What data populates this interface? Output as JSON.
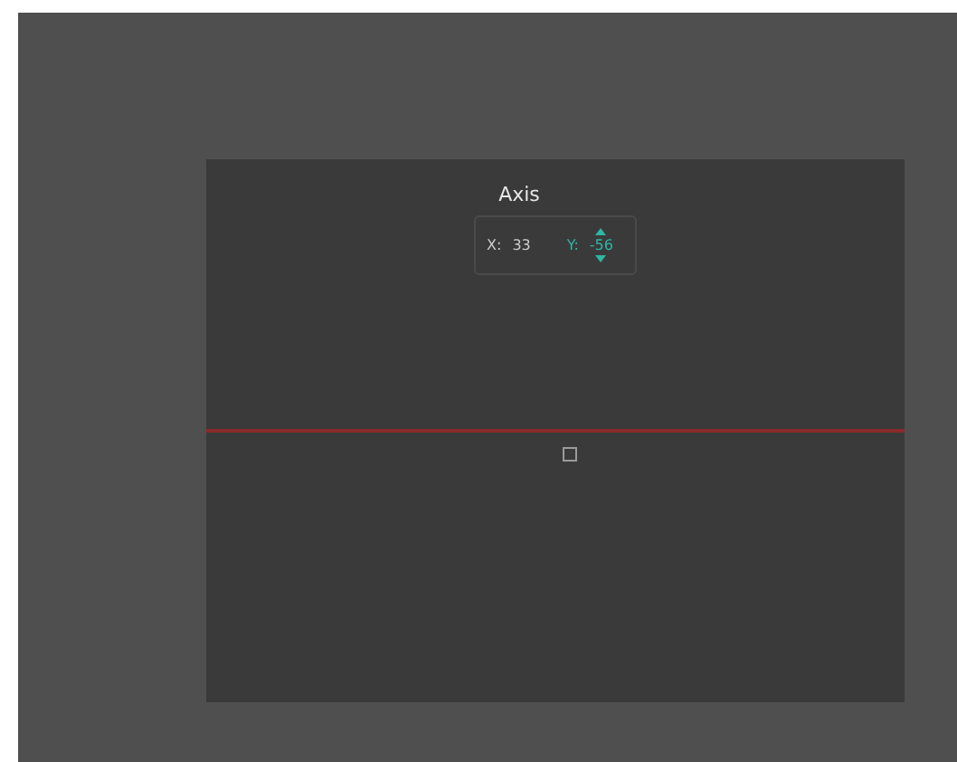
{
  "panel": {
    "title": "Axis",
    "x_label": "X:",
    "x_value": "33",
    "y_label": "Y:",
    "y_value": "-56"
  }
}
